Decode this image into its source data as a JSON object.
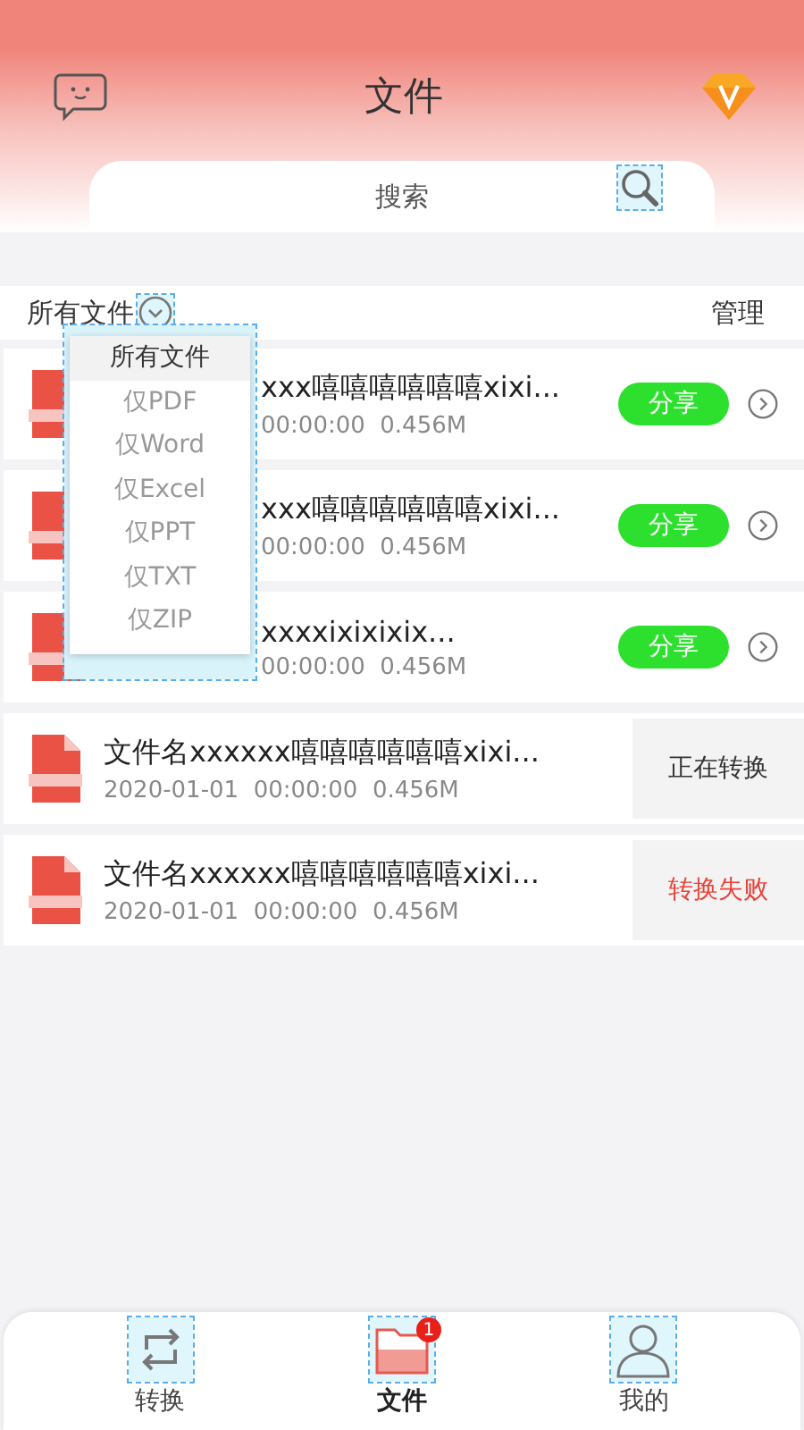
{
  "header": {
    "title": "文件"
  },
  "search": {
    "placeholder": "搜索"
  },
  "filter": {
    "label": "所有文件",
    "manage": "管理",
    "expanded": true,
    "options": [
      {
        "label": "所有文件",
        "selected": true
      },
      {
        "label": "仅PDF",
        "selected": false
      },
      {
        "label": "仅Word",
        "selected": false
      },
      {
        "label": "仅Excel",
        "selected": false
      },
      {
        "label": "仅PPT",
        "selected": false
      },
      {
        "label": "仅TXT",
        "selected": false
      },
      {
        "label": "仅ZIP",
        "selected": false
      }
    ]
  },
  "files": [
    {
      "kind": "partial",
      "name": "xxx嘻嘻嘻嘻嘻嘻xixi...",
      "meta": "00:00:00  0.456M",
      "action": {
        "kind": "share",
        "label": "分享"
      }
    },
    {
      "kind": "partial",
      "name": "xxx嘻嘻嘻嘻嘻嘻xixi...",
      "meta": "00:00:00  0.456M",
      "action": {
        "kind": "share",
        "label": "分享"
      }
    },
    {
      "kind": "partial",
      "name": "xxxxixixixix...",
      "meta": "00:00:00  0.456M",
      "action": {
        "kind": "share",
        "label": "分享"
      }
    },
    {
      "kind": "full",
      "name": "文件名xxxxxx嘻嘻嘻嘻嘻嘻xixi...",
      "meta": "2020-01-01  00:00:00  0.456M",
      "action": {
        "kind": "converting",
        "label": "正在转换"
      }
    },
    {
      "kind": "full",
      "name": "文件名xxxxxx嘻嘻嘻嘻嘻嘻xixi...",
      "meta": "2020-01-01  00:00:00  0.456M",
      "action": {
        "kind": "failed",
        "label": "转换失败"
      }
    }
  ],
  "tabs": [
    {
      "kind": "convert",
      "label": "转换",
      "selected": false
    },
    {
      "kind": "files",
      "label": "文件",
      "selected": true,
      "badge": "1"
    },
    {
      "kind": "mine",
      "label": "我的",
      "selected": false
    }
  ]
}
